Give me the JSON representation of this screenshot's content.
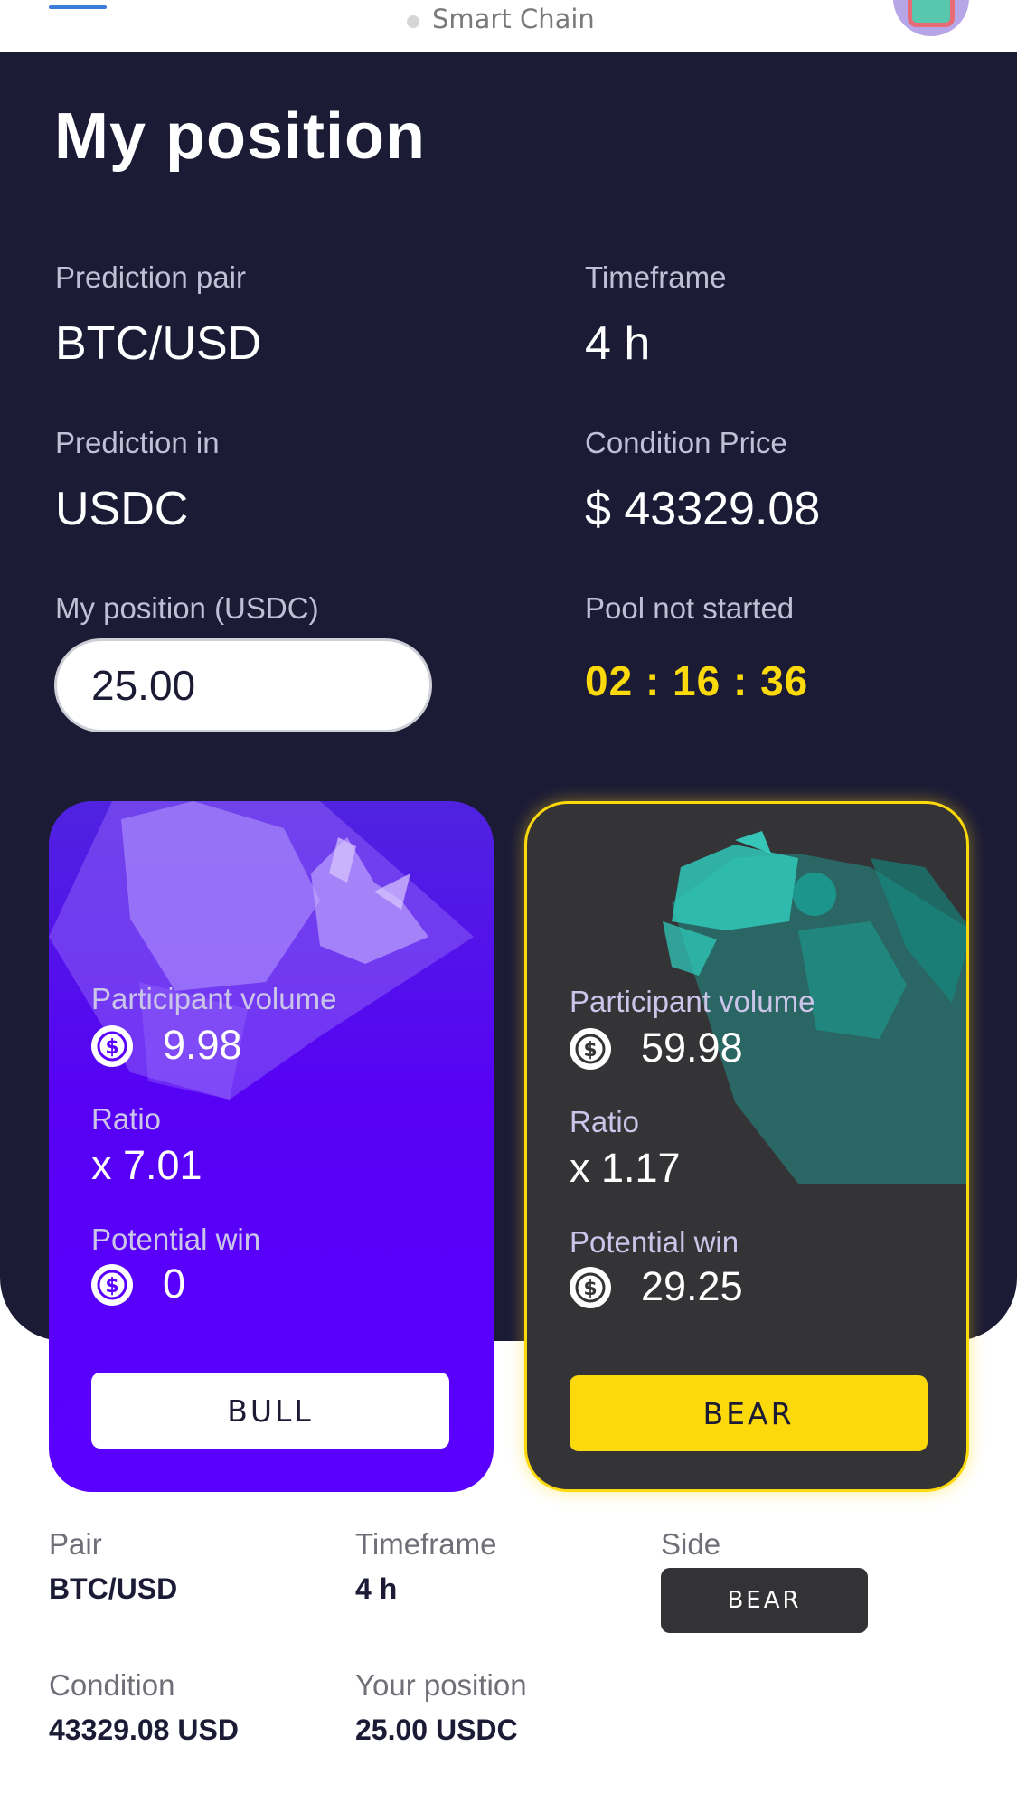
{
  "header": {
    "network_label": "Smart Chain"
  },
  "page": {
    "title": "My position"
  },
  "details": {
    "prediction_pair_label": "Prediction pair",
    "prediction_pair_value": "BTC/USD",
    "timeframe_label": "Timeframe",
    "timeframe_value": "4 h",
    "prediction_in_label": "Prediction in",
    "prediction_in_value": "USDC",
    "condition_price_label": "Condition Price",
    "condition_price_value": "$ 43329.08",
    "my_position_label": "My position (USDC)",
    "my_position_value": "25.00",
    "pool_status_label": "Pool not started",
    "countdown": "02 : 16 : 36"
  },
  "cards": {
    "bull": {
      "participant_volume_label": "Participant volume",
      "participant_volume_value": "9.98",
      "ratio_label": "Ratio",
      "ratio_value": "x 7.01",
      "potential_win_label": "Potential win",
      "potential_win_value": "0",
      "button_label": "BULL"
    },
    "bear": {
      "participant_volume_label": "Participant volume",
      "participant_volume_value": "59.98",
      "ratio_label": "Ratio",
      "ratio_value": "x 1.17",
      "potential_win_label": "Potential win",
      "potential_win_value": "29.25",
      "button_label": "BEAR",
      "selected": true
    }
  },
  "summary": {
    "pair_label": "Pair",
    "pair_value": "BTC/USD",
    "timeframe_label": "Timeframe",
    "timeframe_value": "4 h",
    "side_label": "Side",
    "side_value": "BEAR",
    "condition_label": "Condition",
    "condition_value": "43329.08 USD",
    "position_label": "Your position",
    "position_value": "25.00 USDC"
  },
  "icons": {
    "menu": "hamburger-menu-icon",
    "network_status": "status-dot-icon",
    "avatar": "avatar-icon",
    "coin": "usdc-coin-icon",
    "bull": "bull-illustration",
    "bear": "bear-illustration"
  },
  "colors": {
    "panel_background": "#1c1b36",
    "bull_card": "#5a00ff",
    "bear_card": "#343437",
    "accent_yellow": "#fcd90a",
    "network_dot": "#d6d6d6"
  }
}
